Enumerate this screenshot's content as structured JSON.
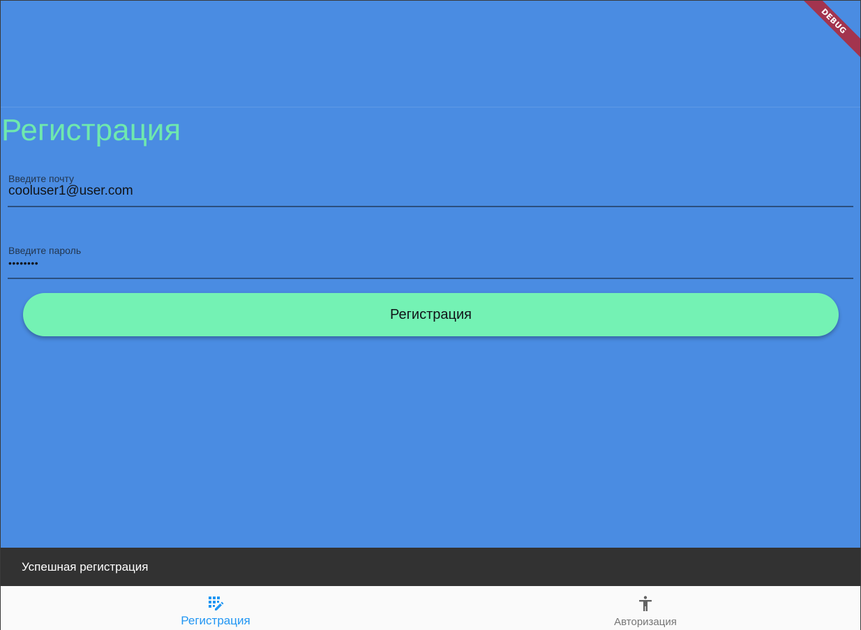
{
  "debug_banner": "DEBUG",
  "page": {
    "title": "Регистрация"
  },
  "email_field": {
    "label": "Введите почту",
    "value": "cooluser1@user.com"
  },
  "password_field": {
    "label": "Введите пароль",
    "value": "••••••••"
  },
  "register_button": {
    "label": "Регистрация"
  },
  "snackbar": {
    "message": "Успешная регистрация"
  },
  "bottom_nav": {
    "items": [
      {
        "label": "Регистрация",
        "icon": "app-registration-icon",
        "active": true
      },
      {
        "label": "Авторизация",
        "icon": "accessibility-icon",
        "active": false
      }
    ]
  },
  "colors": {
    "background": "#4a8ce2",
    "title": "#6fe8ae",
    "button": "#74f2b4",
    "snackbar": "#323232",
    "nav_active": "#2196f3",
    "nav_inactive": "#757575",
    "debug_ribbon": "#a3344e"
  }
}
